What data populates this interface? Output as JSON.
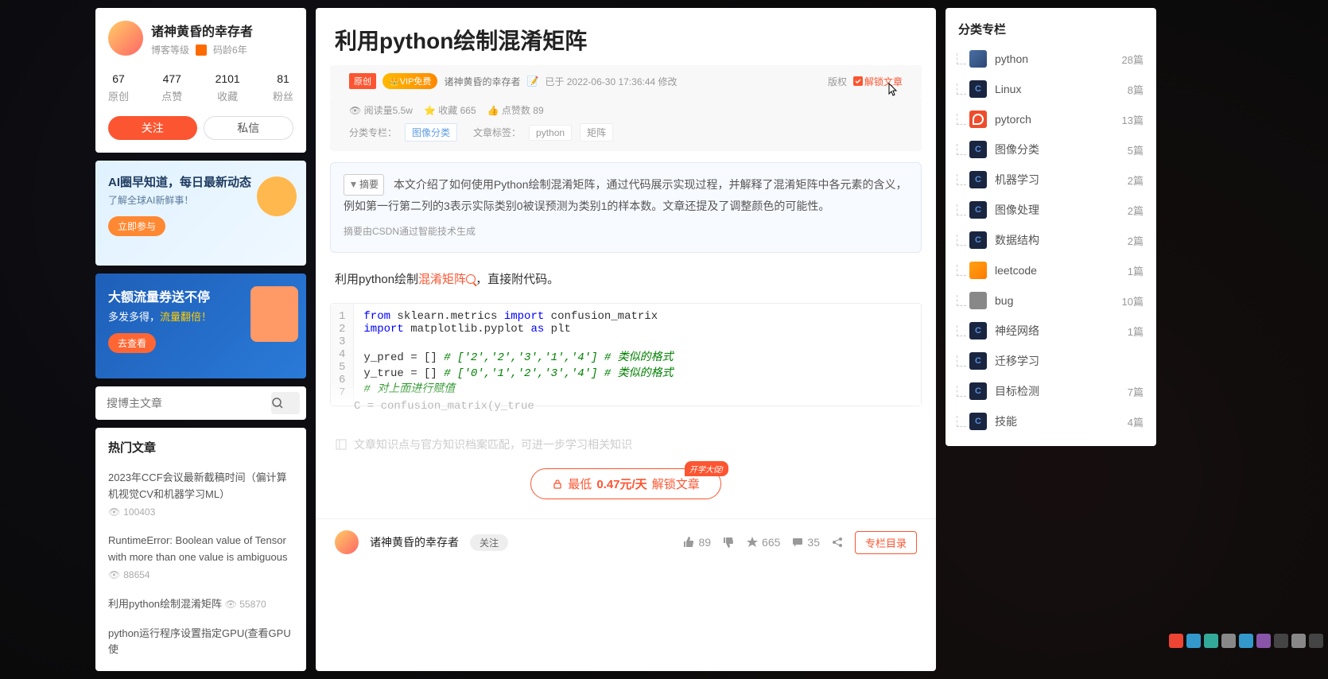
{
  "author": {
    "name": "诸神黄昏的幸存者",
    "blog_level_label": "博客等级",
    "code_age": "码龄6年",
    "stats": [
      {
        "num": "67",
        "label": "原创"
      },
      {
        "num": "477",
        "label": "点赞"
      },
      {
        "num": "2101",
        "label": "收藏"
      },
      {
        "num": "81",
        "label": "粉丝"
      }
    ],
    "follow_btn": "关注",
    "message_btn": "私信"
  },
  "promo1": {
    "title": "AI圈早知道，每日最新动态",
    "subtitle": "了解全球AI新鲜事！",
    "button": "立即参与"
  },
  "promo2": {
    "title": "大额流量券送不停",
    "sub_a": "多发多得，",
    "sub_b": "流量翻倍！",
    "button": "去查看"
  },
  "search": {
    "placeholder": "搜博主文章"
  },
  "hot": {
    "title": "热门文章",
    "items": [
      {
        "title": "2023年CCF会议最新截稿时间（偏计算机视觉CV和机器学习ML）",
        "views": "100403"
      },
      {
        "title": "RuntimeError: Boolean value of Tensor with more than one value is ambiguous",
        "views": "88654"
      },
      {
        "title": "利用python绘制混淆矩阵",
        "views": "55870"
      },
      {
        "title": "python运行程序设置指定GPU(查看GPU使"
      }
    ]
  },
  "article": {
    "title": "利用python绘制混淆矩阵",
    "original_tag": "原创",
    "vip_tag": "VIP免费",
    "author": "诸神黄昏的幸存者",
    "modified": "已于 2022-06-30 17:36:44 修改",
    "copyright": "版权",
    "unlock_link": "解锁文章",
    "views_label": "阅读量",
    "views": "5.5w",
    "fav_label": "收藏",
    "fav": "665",
    "like_label": "点赞数",
    "like": "89",
    "category_label": "分类专栏：",
    "category": "图像分类",
    "tags_label": "文章标签：",
    "tags": [
      "python",
      "矩阵"
    ],
    "abstract_label": "摘要",
    "abstract": "本文介绍了如何使用Python绘制混淆矩阵，通过代码展示实现过程，并解释了混淆矩阵中各元素的含义，例如第一行第二列的3表示实际类别0被误预测为类别1的样本数。文章还提及了调整颜色的可能性。",
    "abstract_note": "摘要由CSDN通过智能技术生成",
    "body_prefix": "利用python绘制",
    "body_keyword": "混淆矩阵",
    "body_suffix": "，直接附代码。",
    "code_lines": [
      "from sklearn.metrics import confusion_matrix",
      "import matplotlib.pyplot as plt",
      "",
      "y_pred = [] # ['2','2','3','1','4'] # 类似的格式",
      "y_true = [] # ['0','1','2','3','4'] # 类似的格式",
      "# 对上面进行赋值",
      ""
    ],
    "code_fade": "C = confusion_matrix(y_true",
    "knowledge_prompt": "文章知识点与官方知识档案匹配，可进一步学习相关知识",
    "unlock_cta_prefix": "最低",
    "unlock_cta_price": "0.47元/天",
    "unlock_cta_suffix": " 解锁文章",
    "unlock_badge": "开学大促!"
  },
  "footer": {
    "author": "诸神黄昏的幸存者",
    "follow": "关注",
    "like": "89",
    "star": "665",
    "comment": "35",
    "catalog": "专栏目录"
  },
  "categories": {
    "title": "分类专栏",
    "items": [
      {
        "name": "python",
        "count": "28篇",
        "ico": "py"
      },
      {
        "name": "Linux",
        "count": "8篇",
        "ico": ""
      },
      {
        "name": "pytorch",
        "count": "13篇",
        "ico": "pt"
      },
      {
        "name": "图像分类",
        "count": "5篇",
        "ico": ""
      },
      {
        "name": "机器学习",
        "count": "2篇",
        "ico": ""
      },
      {
        "name": "图像处理",
        "count": "2篇",
        "ico": ""
      },
      {
        "name": "数据结构",
        "count": "2篇",
        "ico": ""
      },
      {
        "name": "leetcode",
        "count": "1篇",
        "ico": "lc"
      },
      {
        "name": "bug",
        "count": "10篇",
        "ico": "bug"
      },
      {
        "name": "神经网络",
        "count": "1篇",
        "ico": ""
      },
      {
        "name": "迁移学习",
        "count": "",
        "ico": ""
      },
      {
        "name": "目标检测",
        "count": "7篇",
        "ico": ""
      },
      {
        "name": "技能",
        "count": "4篇",
        "ico": ""
      }
    ]
  }
}
